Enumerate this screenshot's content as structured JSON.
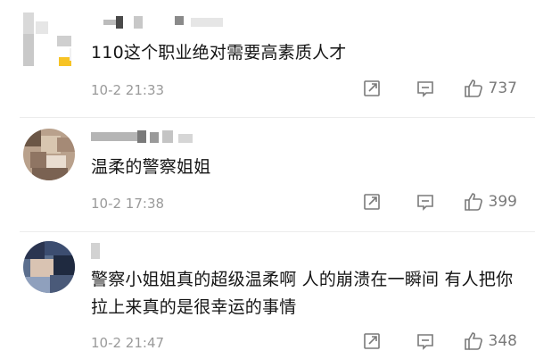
{
  "comments": [
    {
      "text": "110这个职业绝对需要高素质人才",
      "time": "10-2 21:33",
      "likes": "737"
    },
    {
      "text": "温柔的警察姐姐",
      "time": "10-2 17:38",
      "likes": "399"
    },
    {
      "text": "警察小姐姐真的超级温柔啊 人的崩溃在一瞬间 有人把你拉上来真的是很幸运的事情",
      "time": "10-2 21:47",
      "likes": "348"
    }
  ],
  "icons": {
    "share": "share-icon",
    "reply": "reply-icon",
    "like": "thumbs-up-icon"
  },
  "colors": {
    "meta_text": "#9a9a9a",
    "icon_stroke": "#7a7a7a",
    "divider": "#ececec",
    "highlight": "#f7c325"
  }
}
